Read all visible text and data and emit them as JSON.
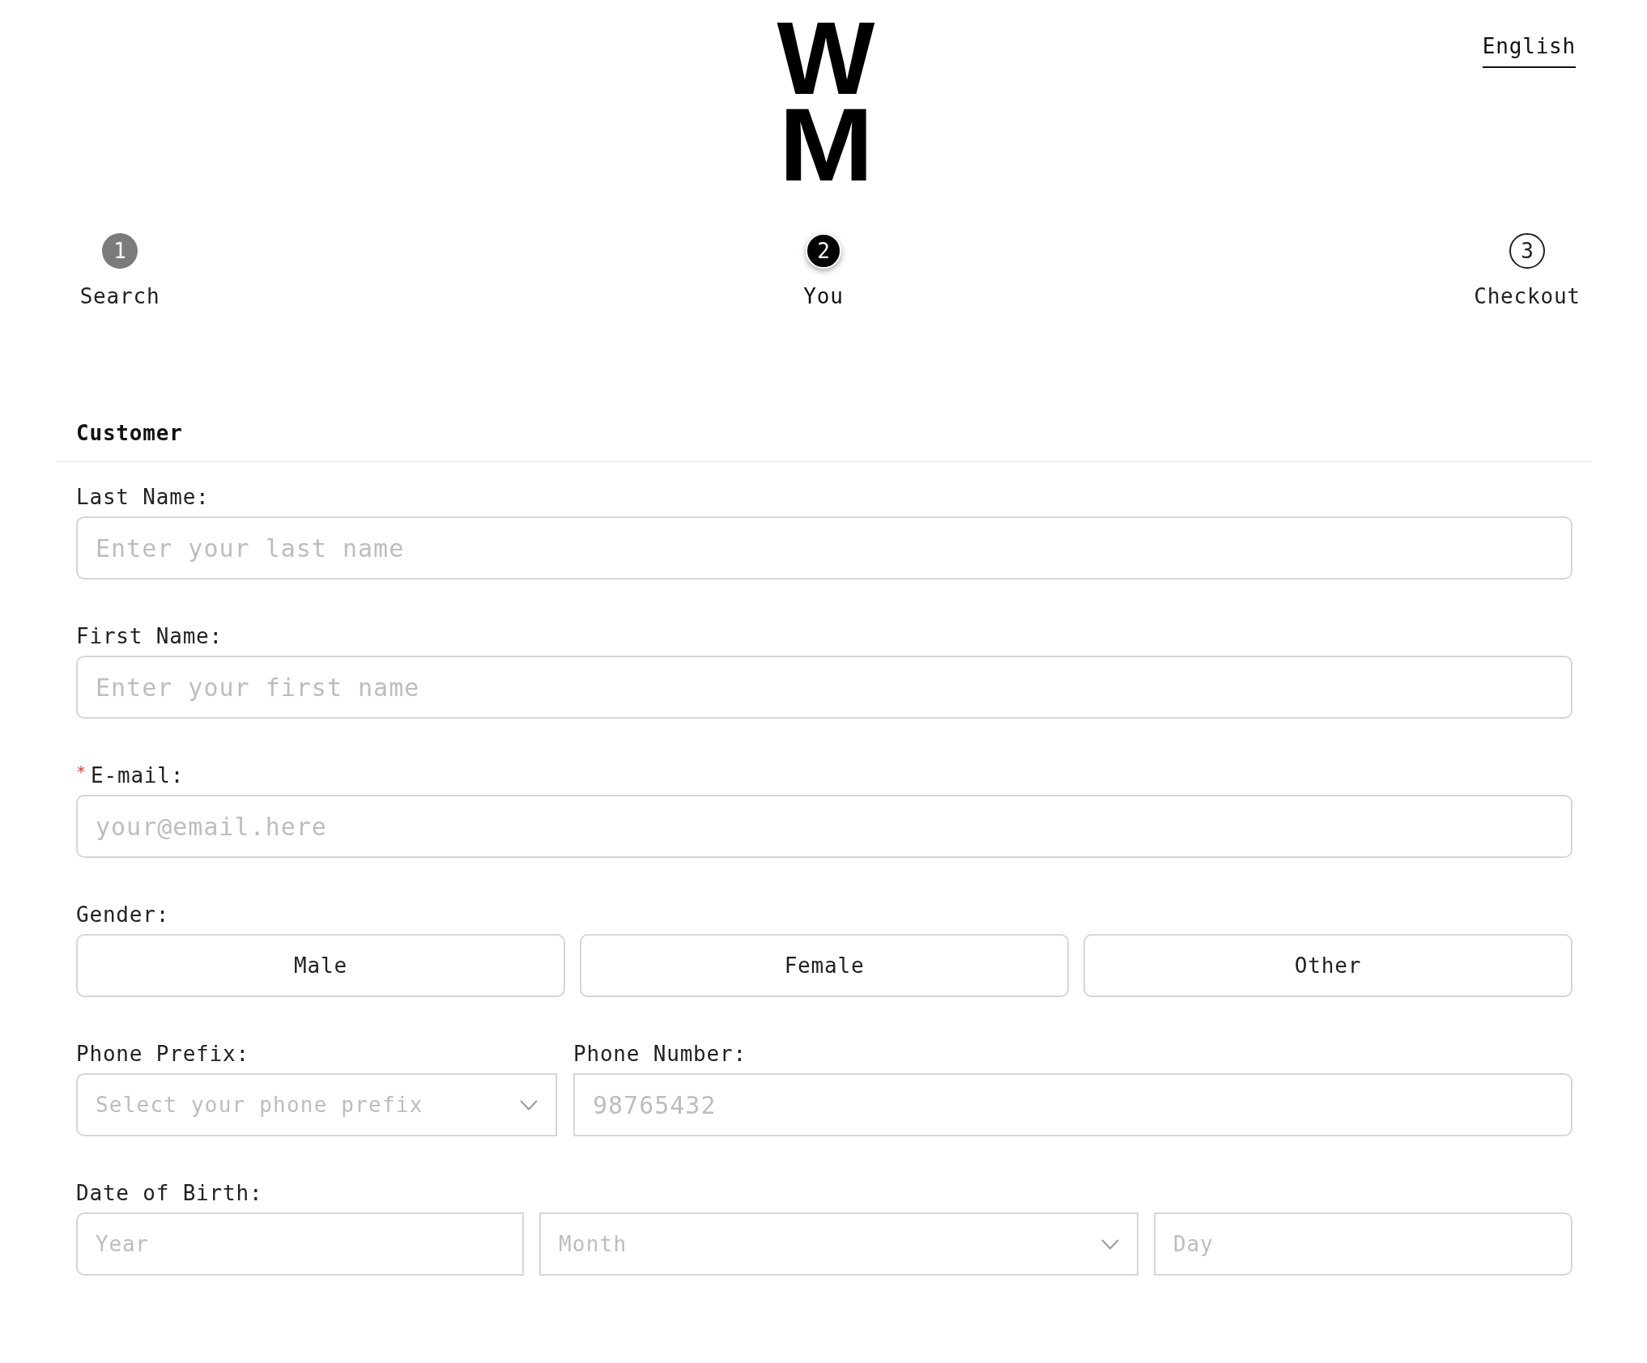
{
  "header": {
    "logo": {
      "lines": [
        "W",
        "M"
      ]
    },
    "language": "English"
  },
  "steps": [
    {
      "number": "1",
      "label": "Search",
      "completed": true,
      "selected": false
    },
    {
      "number": "2",
      "label": "You",
      "completed": false,
      "selected": true
    },
    {
      "number": "3",
      "label": "Checkout",
      "completed": false,
      "selected": false
    }
  ],
  "form": {
    "heading": "Customer",
    "fields": [
      {
        "kind": "input",
        "label": "Last Name:",
        "placeholder": "Enter your last name"
      },
      {
        "kind": "input",
        "label": "First Name:",
        "placeholder": "Enter your first name"
      },
      {
        "kind": "input",
        "label": "E-mail:",
        "required_mark": "*",
        "placeholder": "your@email.here"
      },
      {
        "kind": "options",
        "label": "Gender:",
        "options": [
          {
            "label": "Male",
            "selected": false
          },
          {
            "label": "Female",
            "selected": false
          },
          {
            "label": "Other",
            "selected": false
          }
        ]
      },
      {
        "kind": "row",
        "columns": [
          {
            "label": "Phone Prefix:",
            "control": {
              "kind": "select",
              "placeholder": "Select your phone prefix"
            }
          },
          {
            "label": "Phone Number:",
            "control": {
              "kind": "input",
              "placeholder": "98765432"
            }
          }
        ]
      },
      {
        "kind": "group",
        "label": "Date of Birth:",
        "controls": [
          {
            "kind": "input",
            "placeholder": "Year"
          },
          {
            "kind": "select",
            "placeholder": "Month"
          },
          {
            "kind": "input",
            "placeholder": "Day"
          }
        ]
      }
    ]
  }
}
